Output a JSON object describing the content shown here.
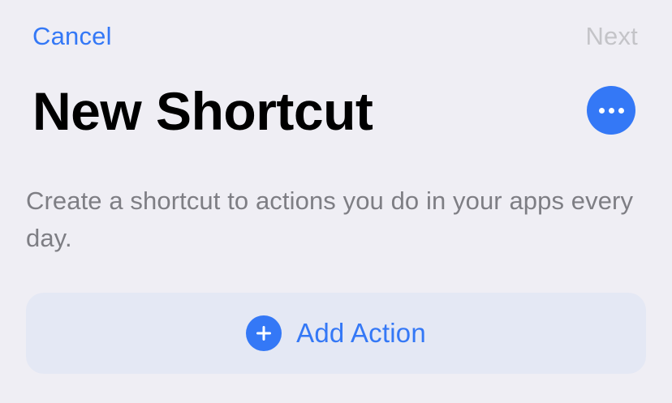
{
  "nav": {
    "cancel_label": "Cancel",
    "next_label": "Next"
  },
  "header": {
    "title": "New Shortcut",
    "more_icon": "ellipsis-icon"
  },
  "main": {
    "description": "Create a shortcut to actions you do in your apps every day.",
    "add_action": {
      "icon": "plus-icon",
      "label": "Add Action"
    }
  },
  "colors": {
    "background": "#efeef4",
    "accent": "#3478f6",
    "disabled": "#c4c4c8",
    "secondary_text": "#7e7e84",
    "action_card": "#e4e8f4"
  }
}
